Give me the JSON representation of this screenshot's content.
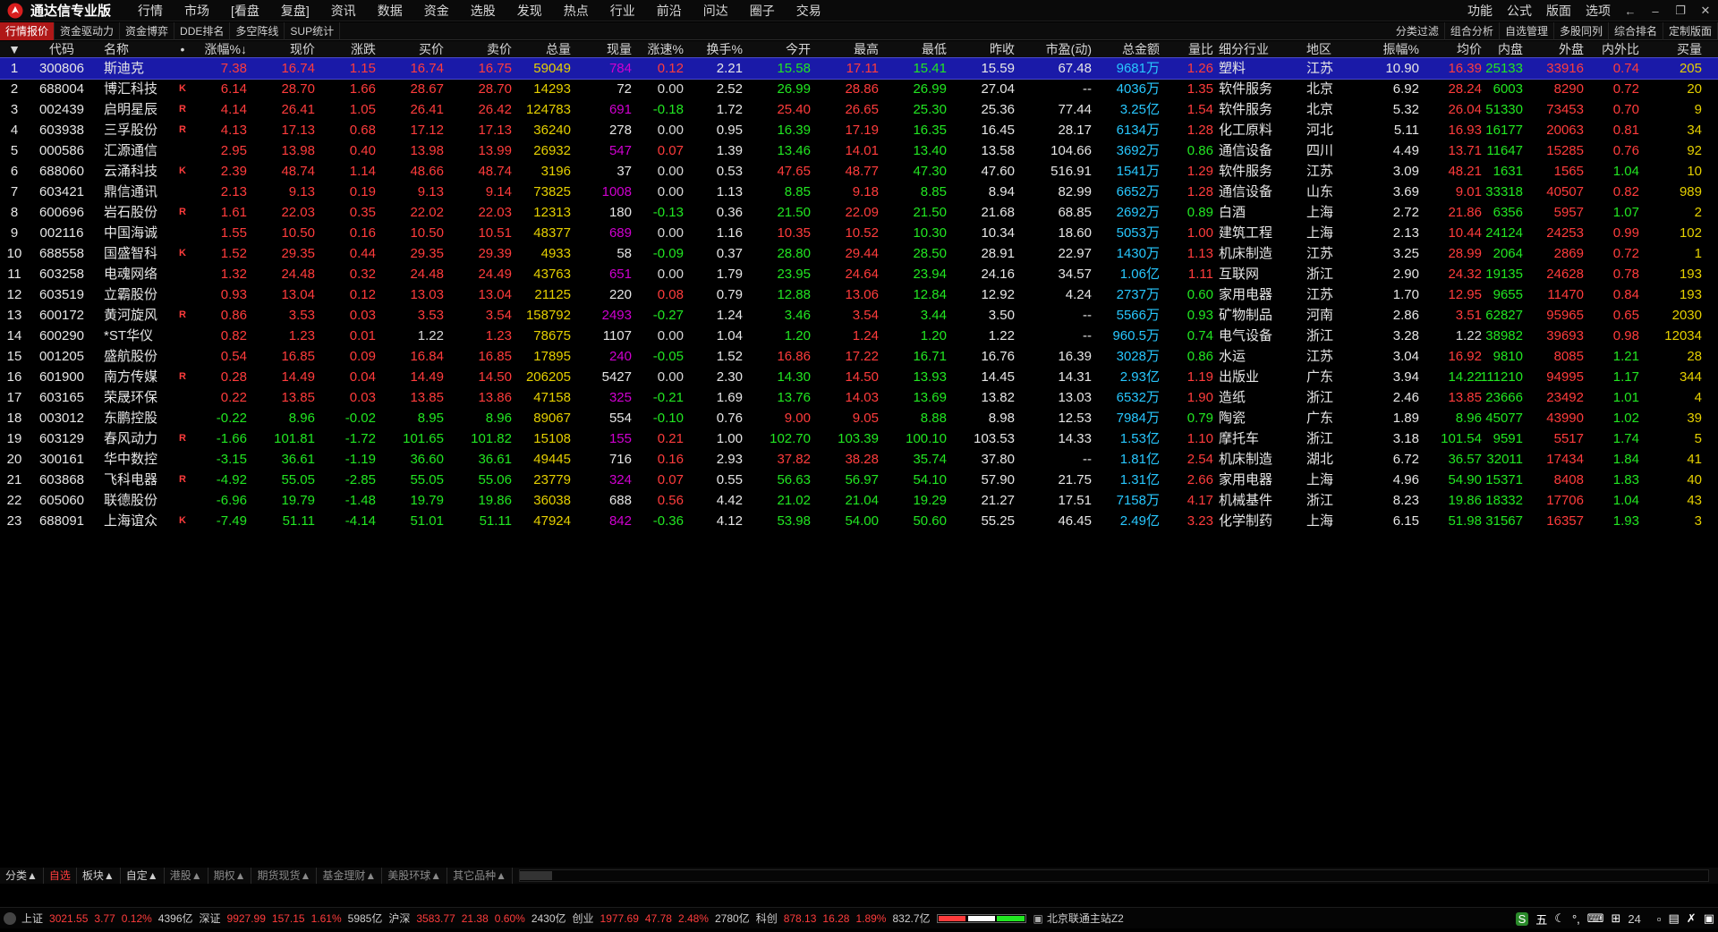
{
  "title_bar": {
    "app_title": "通达信专业版",
    "menu": [
      "行情",
      "市场",
      "[看盘",
      "复盘]",
      "资讯",
      "数据",
      "资金",
      "选股",
      "发现",
      "热点",
      "行业",
      "前沿",
      "问达",
      "圈子",
      "交易"
    ],
    "right_menu": [
      "功能",
      "公式",
      "版面",
      "选项"
    ]
  },
  "toolbar": {
    "tabs": [
      "行情报价",
      "资金驱动力",
      "资金博弈",
      "DDE排名",
      "多空阵线",
      "SUP统计"
    ],
    "right_tabs": [
      "分类过滤",
      "组合分析",
      "自选管理",
      "多股同列",
      "综合排名",
      "定制版面"
    ]
  },
  "table": {
    "headers": [
      "▼",
      "代码",
      "名称",
      "•",
      "涨幅%↓",
      "现价",
      "涨跌",
      "买价",
      "卖价",
      "总量",
      "现量",
      "涨速%",
      "换手%",
      "今开",
      "最高",
      "最低",
      "昨收",
      "市盈(动)",
      "总金额",
      "量比",
      "细分行业",
      "地区",
      "振幅%",
      "均价",
      "内盘",
      "外盘",
      "内外比",
      "买量"
    ],
    "rows": [
      [
        "1",
        "300806",
        "斯迪克",
        "",
        "7.38",
        "16.74",
        "1.15",
        "16.74",
        "16.75",
        "59049",
        "784",
        "0.12",
        "2.21",
        "15.58",
        "17.11",
        "15.41",
        "15.59",
        "67.48",
        "9681万",
        "1.26",
        "塑料",
        "江苏",
        "10.90",
        "16.39",
        "25133",
        "33916",
        "0.74",
        "205"
      ],
      [
        "2",
        "688004",
        "博汇科技",
        "K",
        "6.14",
        "28.70",
        "1.66",
        "28.67",
        "28.70",
        "14293",
        "72",
        "0.00",
        "2.52",
        "26.99",
        "28.86",
        "26.99",
        "27.04",
        "--",
        "4036万",
        "1.35",
        "软件服务",
        "北京",
        "6.92",
        "28.24",
        "6003",
        "8290",
        "0.72",
        "20"
      ],
      [
        "3",
        "002439",
        "启明星辰",
        "R",
        "4.14",
        "26.41",
        "1.05",
        "26.41",
        "26.42",
        "124783",
        "691",
        "-0.18",
        "1.72",
        "25.40",
        "26.65",
        "25.30",
        "25.36",
        "77.44",
        "3.25亿",
        "1.54",
        "软件服务",
        "北京",
        "5.32",
        "26.04",
        "51330",
        "73453",
        "0.70",
        "9"
      ],
      [
        "4",
        "603938",
        "三孚股份",
        "R",
        "4.13",
        "17.13",
        "0.68",
        "17.12",
        "17.13",
        "36240",
        "278",
        "0.00",
        "0.95",
        "16.39",
        "17.19",
        "16.35",
        "16.45",
        "28.17",
        "6134万",
        "1.28",
        "化工原料",
        "河北",
        "5.11",
        "16.93",
        "16177",
        "20063",
        "0.81",
        "34"
      ],
      [
        "5",
        "000586",
        "汇源通信",
        "",
        "2.95",
        "13.98",
        "0.40",
        "13.98",
        "13.99",
        "26932",
        "547",
        "0.07",
        "1.39",
        "13.46",
        "14.01",
        "13.40",
        "13.58",
        "104.66",
        "3692万",
        "0.86",
        "通信设备",
        "四川",
        "4.49",
        "13.71",
        "11647",
        "15285",
        "0.76",
        "92"
      ],
      [
        "6",
        "688060",
        "云涌科技",
        "K",
        "2.39",
        "48.74",
        "1.14",
        "48.66",
        "48.74",
        "3196",
        "37",
        "0.00",
        "0.53",
        "47.65",
        "48.77",
        "47.30",
        "47.60",
        "516.91",
        "1541万",
        "1.29",
        "软件服务",
        "江苏",
        "3.09",
        "48.21",
        "1631",
        "1565",
        "1.04",
        "10"
      ],
      [
        "7",
        "603421",
        "鼎信通讯",
        "",
        "2.13",
        "9.13",
        "0.19",
        "9.13",
        "9.14",
        "73825",
        "1008",
        "0.00",
        "1.13",
        "8.85",
        "9.18",
        "8.85",
        "8.94",
        "82.99",
        "6652万",
        "1.28",
        "通信设备",
        "山东",
        "3.69",
        "9.01",
        "33318",
        "40507",
        "0.82",
        "989"
      ],
      [
        "8",
        "600696",
        "岩石股份",
        "R",
        "1.61",
        "22.03",
        "0.35",
        "22.02",
        "22.03",
        "12313",
        "180",
        "-0.13",
        "0.36",
        "21.50",
        "22.09",
        "21.50",
        "21.68",
        "68.85",
        "2692万",
        "0.89",
        "白酒",
        "上海",
        "2.72",
        "21.86",
        "6356",
        "5957",
        "1.07",
        "2"
      ],
      [
        "9",
        "002116",
        "中国海诚",
        "",
        "1.55",
        "10.50",
        "0.16",
        "10.50",
        "10.51",
        "48377",
        "689",
        "0.00",
        "1.16",
        "10.35",
        "10.52",
        "10.30",
        "10.34",
        "18.60",
        "5053万",
        "1.00",
        "建筑工程",
        "上海",
        "2.13",
        "10.44",
        "24124",
        "24253",
        "0.99",
        "102"
      ],
      [
        "10",
        "688558",
        "国盛智科",
        "K",
        "1.52",
        "29.35",
        "0.44",
        "29.35",
        "29.39",
        "4933",
        "58",
        "-0.09",
        "0.37",
        "28.80",
        "29.44",
        "28.50",
        "28.91",
        "22.97",
        "1430万",
        "1.13",
        "机床制造",
        "江苏",
        "3.25",
        "28.99",
        "2064",
        "2869",
        "0.72",
        "1"
      ],
      [
        "11",
        "603258",
        "电魂网络",
        "",
        "1.32",
        "24.48",
        "0.32",
        "24.48",
        "24.49",
        "43763",
        "651",
        "0.00",
        "1.79",
        "23.95",
        "24.64",
        "23.94",
        "24.16",
        "34.57",
        "1.06亿",
        "1.11",
        "互联网",
        "浙江",
        "2.90",
        "24.32",
        "19135",
        "24628",
        "0.78",
        "193"
      ],
      [
        "12",
        "603519",
        "立霸股份",
        "",
        "0.93",
        "13.04",
        "0.12",
        "13.03",
        "13.04",
        "21125",
        "220",
        "0.08",
        "0.79",
        "12.88",
        "13.06",
        "12.84",
        "12.92",
        "4.24",
        "2737万",
        "0.60",
        "家用电器",
        "江苏",
        "1.70",
        "12.95",
        "9655",
        "11470",
        "0.84",
        "193"
      ],
      [
        "13",
        "600172",
        "黄河旋风",
        "R",
        "0.86",
        "3.53",
        "0.03",
        "3.53",
        "3.54",
        "158792",
        "2493",
        "-0.27",
        "1.24",
        "3.46",
        "3.54",
        "3.44",
        "3.50",
        "--",
        "5566万",
        "0.93",
        "矿物制品",
        "河南",
        "2.86",
        "3.51",
        "62827",
        "95965",
        "0.65",
        "2030"
      ],
      [
        "14",
        "600290",
        "*ST华仪",
        "",
        "0.82",
        "1.23",
        "0.01",
        "1.22",
        "1.23",
        "78675",
        "1107",
        "0.00",
        "1.04",
        "1.20",
        "1.24",
        "1.20",
        "1.22",
        "--",
        "960.5万",
        "0.74",
        "电气设备",
        "浙江",
        "3.28",
        "1.22",
        "38982",
        "39693",
        "0.98",
        "12034"
      ],
      [
        "15",
        "001205",
        "盛航股份",
        "",
        "0.54",
        "16.85",
        "0.09",
        "16.84",
        "16.85",
        "17895",
        "240",
        "-0.05",
        "1.52",
        "16.86",
        "17.22",
        "16.71",
        "16.76",
        "16.39",
        "3028万",
        "0.86",
        "水运",
        "江苏",
        "3.04",
        "16.92",
        "9810",
        "8085",
        "1.21",
        "28"
      ],
      [
        "16",
        "601900",
        "南方传媒",
        "R",
        "0.28",
        "14.49",
        "0.04",
        "14.49",
        "14.50",
        "206205",
        "5427",
        "0.00",
        "2.30",
        "14.30",
        "14.50",
        "13.93",
        "14.45",
        "14.31",
        "2.93亿",
        "1.19",
        "出版业",
        "广东",
        "3.94",
        "14.22",
        "111210",
        "94995",
        "1.17",
        "344"
      ],
      [
        "17",
        "603165",
        "荣晟环保",
        "",
        "0.22",
        "13.85",
        "0.03",
        "13.85",
        "13.86",
        "47158",
        "325",
        "-0.21",
        "1.69",
        "13.76",
        "14.03",
        "13.69",
        "13.82",
        "13.03",
        "6532万",
        "1.90",
        "造纸",
        "浙江",
        "2.46",
        "13.85",
        "23666",
        "23492",
        "1.01",
        "4"
      ],
      [
        "18",
        "003012",
        "东鹏控股",
        "",
        "-0.22",
        "8.96",
        "-0.02",
        "8.95",
        "8.96",
        "89067",
        "554",
        "-0.10",
        "0.76",
        "9.00",
        "9.05",
        "8.88",
        "8.98",
        "12.53",
        "7984万",
        "0.79",
        "陶瓷",
        "广东",
        "1.89",
        "8.96",
        "45077",
        "43990",
        "1.02",
        "39"
      ],
      [
        "19",
        "603129",
        "春风动力",
        "R",
        "-1.66",
        "101.81",
        "-1.72",
        "101.65",
        "101.82",
        "15108",
        "155",
        "0.21",
        "1.00",
        "102.70",
        "103.39",
        "100.10",
        "103.53",
        "14.33",
        "1.53亿",
        "1.10",
        "摩托车",
        "浙江",
        "3.18",
        "101.54",
        "9591",
        "5517",
        "1.74",
        "5"
      ],
      [
        "20",
        "300161",
        "华中数控",
        "",
        "-3.15",
        "36.61",
        "-1.19",
        "36.60",
        "36.61",
        "49445",
        "716",
        "0.16",
        "2.93",
        "37.82",
        "38.28",
        "35.74",
        "37.80",
        "--",
        "1.81亿",
        "2.54",
        "机床制造",
        "湖北",
        "6.72",
        "36.57",
        "32011",
        "17434",
        "1.84",
        "41"
      ],
      [
        "21",
        "603868",
        "飞科电器",
        "R",
        "-4.92",
        "55.05",
        "-2.85",
        "55.05",
        "55.06",
        "23779",
        "324",
        "0.07",
        "0.55",
        "56.63",
        "56.97",
        "54.10",
        "57.90",
        "21.75",
        "1.31亿",
        "2.66",
        "家用电器",
        "上海",
        "4.96",
        "54.90",
        "15371",
        "8408",
        "1.83",
        "40"
      ],
      [
        "22",
        "605060",
        "联德股份",
        "",
        "-6.96",
        "19.79",
        "-1.48",
        "19.79",
        "19.86",
        "36038",
        "688",
        "0.56",
        "4.42",
        "21.02",
        "21.04",
        "19.29",
        "21.27",
        "17.51",
        "7158万",
        "4.17",
        "机械基件",
        "浙江",
        "8.23",
        "19.86",
        "18332",
        "17706",
        "1.04",
        "43"
      ],
      [
        "23",
        "688091",
        "上海谊众",
        "K",
        "-7.49",
        "51.11",
        "-4.14",
        "51.01",
        "51.11",
        "47924",
        "842",
        "-0.36",
        "4.12",
        "53.98",
        "54.00",
        "50.60",
        "55.25",
        "46.45",
        "2.49亿",
        "3.23",
        "化学制药",
        "上海",
        "6.15",
        "51.98",
        "31567",
        "16357",
        "1.93",
        "3"
      ]
    ]
  },
  "category_tabs": [
    "分类▲",
    "自选",
    "板块▲",
    "自定▲",
    "港股▲",
    "期权▲",
    "期货现货▲",
    "基金理财▲",
    "美股环球▲",
    "其它品种▲"
  ],
  "status_bar": {
    "indices": [
      {
        "name": "上证",
        "value": "3021.55",
        "chg": "3.77",
        "pct": "0.12%",
        "amount": "4396亿"
      },
      {
        "name": "深证",
        "value": "9927.99",
        "chg": "157.15",
        "pct": "1.61%",
        "amount": "5985亿"
      },
      {
        "name": "沪深",
        "value": "3583.77",
        "chg": "21.38",
        "pct": "0.60%",
        "amount": "2430亿"
      },
      {
        "name": "创业",
        "value": "1977.69",
        "chg": "47.78",
        "pct": "2.48%",
        "amount": "2780亿"
      },
      {
        "name": "科创",
        "value": "878.13",
        "chg": "16.28",
        "pct": "1.89%",
        "amount": "832.7亿"
      }
    ],
    "server": "北京联通主站Z2",
    "ime_label": "五",
    "time_fragment": "24"
  },
  "colors": {
    "up": "#ff3c3c",
    "down": "#22e622",
    "selected_row": "#1a1aa8",
    "active_tab": "#b01818",
    "volume": "#e6d000",
    "amount": "#28c8ff",
    "current_volume": "#d000d0"
  },
  "icons": {
    "logo": "tdx-logo-icon",
    "back": "arrow-left-icon",
    "minimize": "minimize-icon",
    "restore": "restore-icon",
    "close": "close-icon"
  }
}
